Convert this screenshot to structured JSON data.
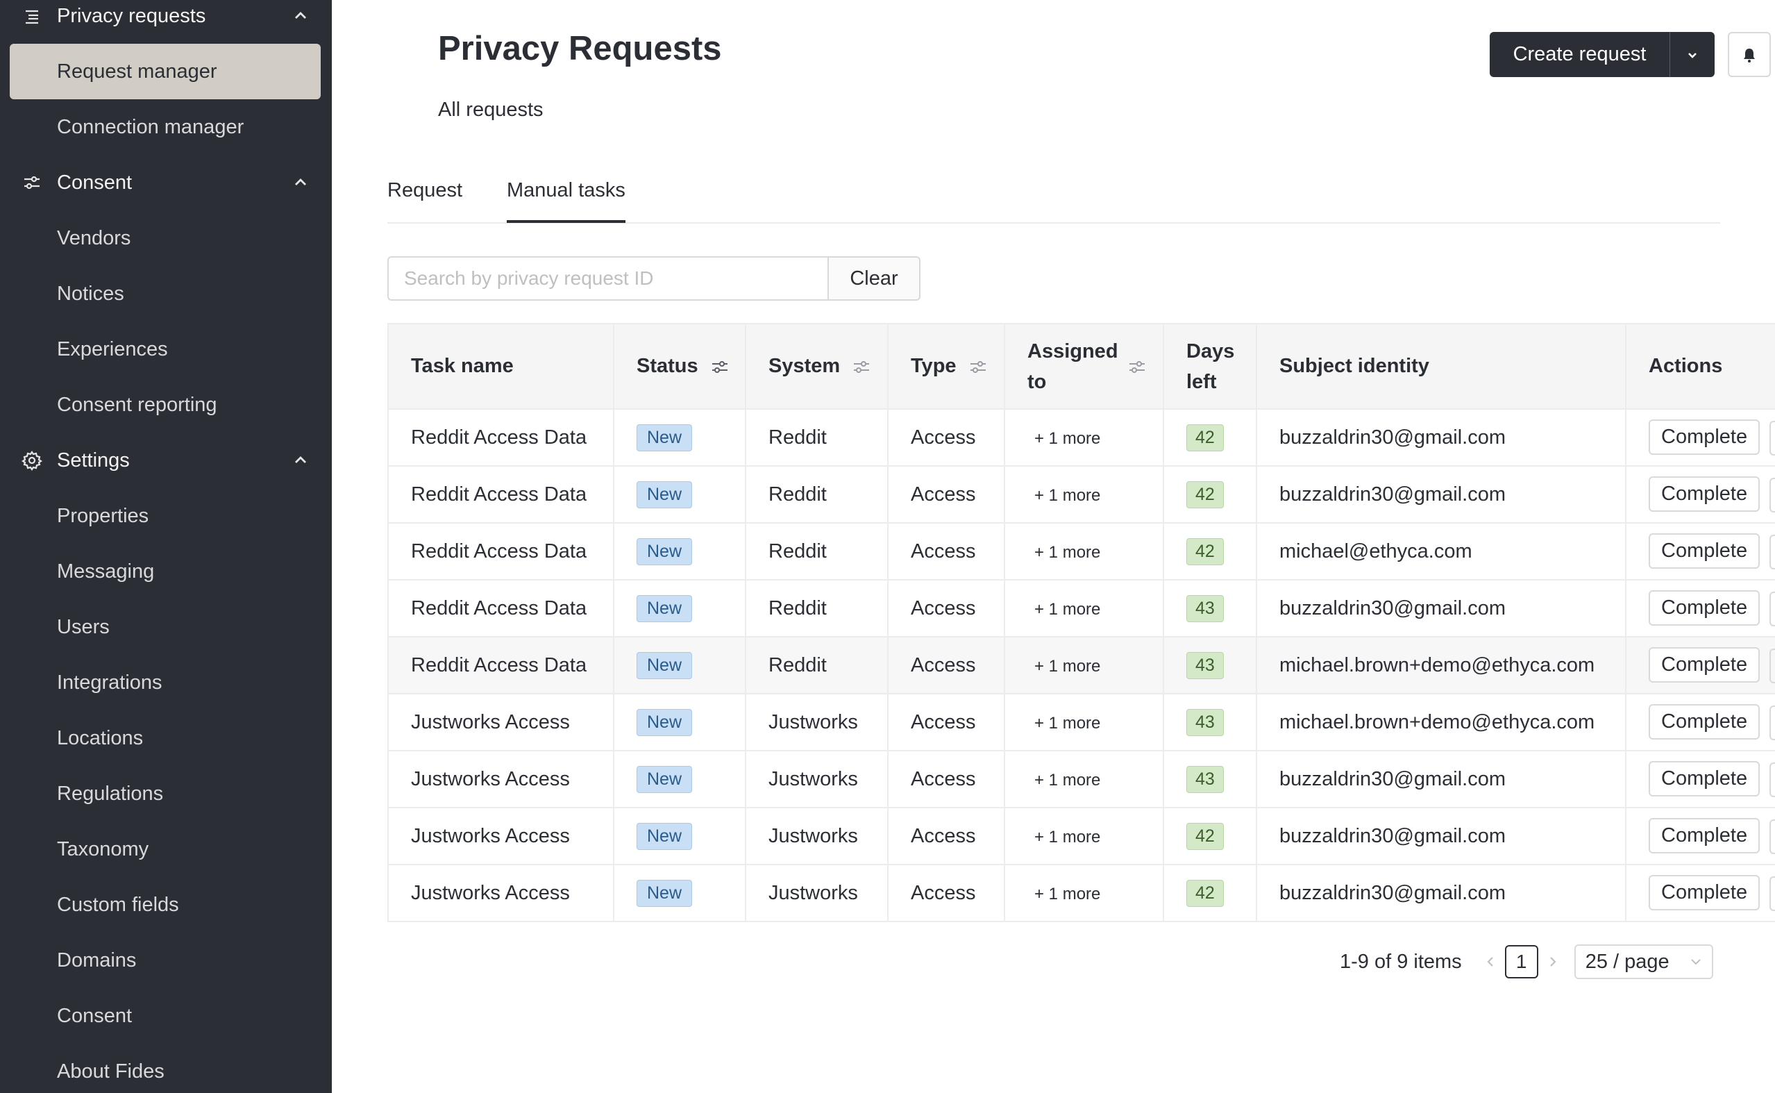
{
  "sidebar": {
    "groups": [
      {
        "label": "Privacy requests",
        "icon": "list-icon"
      },
      {
        "label": "Consent",
        "icon": "sliders-icon"
      },
      {
        "label": "Settings",
        "icon": "gear-icon"
      }
    ],
    "items": {
      "request_manager": "Request manager",
      "connection_manager": "Connection manager",
      "vendors": "Vendors",
      "notices": "Notices",
      "experiences": "Experiences",
      "consent_reporting": "Consent reporting",
      "properties": "Properties",
      "messaging": "Messaging",
      "users": "Users",
      "integrations": "Integrations",
      "locations": "Locations",
      "regulations": "Regulations",
      "taxonomy": "Taxonomy",
      "custom_fields": "Custom fields",
      "domains": "Domains",
      "consent": "Consent",
      "about_fides": "About Fides"
    },
    "active_item": "Request manager"
  },
  "header": {
    "title": "Privacy Requests",
    "subtitle": "All requests",
    "create_button": "Create request"
  },
  "tabs": [
    {
      "label": "Request",
      "active": false
    },
    {
      "label": "Manual tasks",
      "active": true
    }
  ],
  "search": {
    "placeholder": "Search by privacy request ID",
    "value": "",
    "clear_label": "Clear"
  },
  "table": {
    "columns": {
      "task_name": "Task name",
      "status": "Status",
      "system": "System",
      "type": "Type",
      "assigned_line1": "Assigned",
      "assigned_line2": "to",
      "days_line1": "Days",
      "days_line2": "left",
      "subject": "Subject identity",
      "actions": "Actions"
    },
    "action_label": "Complete",
    "rows": [
      {
        "task": "Reddit Access Data",
        "status": "New",
        "system": "Reddit",
        "type": "Access",
        "assigned": "+ 1 more",
        "days": "42",
        "subject": "buzzaldrin30@gmail.com"
      },
      {
        "task": "Reddit Access Data",
        "status": "New",
        "system": "Reddit",
        "type": "Access",
        "assigned": "+ 1 more",
        "days": "42",
        "subject": "buzzaldrin30@gmail.com"
      },
      {
        "task": "Reddit Access Data",
        "status": "New",
        "system": "Reddit",
        "type": "Access",
        "assigned": "+ 1 more",
        "days": "42",
        "subject": "michael@ethyca.com"
      },
      {
        "task": "Reddit Access Data",
        "status": "New",
        "system": "Reddit",
        "type": "Access",
        "assigned": "+ 1 more",
        "days": "43",
        "subject": "buzzaldrin30@gmail.com"
      },
      {
        "task": "Reddit Access Data",
        "status": "New",
        "system": "Reddit",
        "type": "Access",
        "assigned": "+ 1 more",
        "days": "43",
        "subject": "michael.brown+demo@ethyca.com"
      },
      {
        "task": "Justworks Access",
        "status": "New",
        "system": "Justworks",
        "type": "Access",
        "assigned": "+ 1 more",
        "days": "43",
        "subject": "michael.brown+demo@ethyca.com"
      },
      {
        "task": "Justworks Access",
        "status": "New",
        "system": "Justworks",
        "type": "Access",
        "assigned": "+ 1 more",
        "days": "43",
        "subject": "buzzaldrin30@gmail.com"
      },
      {
        "task": "Justworks Access",
        "status": "New",
        "system": "Justworks",
        "type": "Access",
        "assigned": "+ 1 more",
        "days": "42",
        "subject": "buzzaldrin30@gmail.com"
      },
      {
        "task": "Justworks Access",
        "status": "New",
        "system": "Justworks",
        "type": "Access",
        "assigned": "+ 1 more",
        "days": "42",
        "subject": "buzzaldrin30@gmail.com"
      }
    ]
  },
  "pagination": {
    "total_text": "1-9 of 9 items",
    "current_page": "1",
    "page_size": "25 / page"
  },
  "colors": {
    "sidebar_bg": "#2b2e35",
    "active_item_bg": "#d1cdc4",
    "status_new": "#c8dff5",
    "days_badge": "#d4e9c8"
  }
}
